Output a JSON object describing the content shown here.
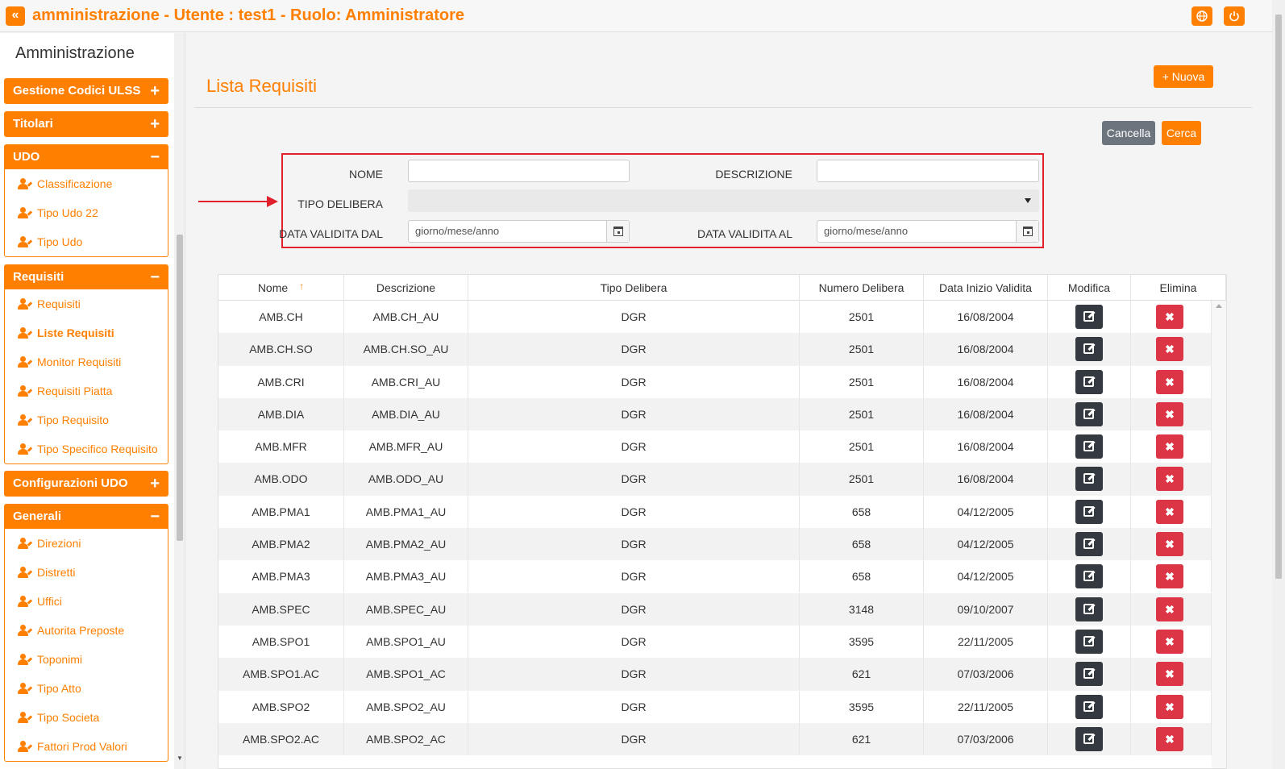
{
  "header": {
    "title": "amministrazione - Utente : test1 - Ruolo: Amministratore",
    "back_icon": "double-chevron-left-icon",
    "globe_icon": "globe-icon",
    "power_icon": "power-icon"
  },
  "sidebar": {
    "title": "Amministrazione",
    "groups": [
      {
        "label": "Gestione Codici ULSS",
        "sign": "+",
        "items": []
      },
      {
        "label": "Titolari",
        "sign": "+",
        "items": []
      },
      {
        "label": "UDO",
        "sign": "−",
        "items": [
          "Classificazione",
          "Tipo Udo 22",
          "Tipo Udo"
        ]
      },
      {
        "label": "Requisiti",
        "sign": "−",
        "items": [
          "Requisiti",
          "Liste Requisiti",
          "Monitor Requisiti",
          "Requisiti Piatta",
          "Tipo Requisito",
          "Tipo Specifico Requisito"
        ]
      },
      {
        "label": "Configurazioni UDO",
        "sign": "+",
        "items": []
      },
      {
        "label": "Generali",
        "sign": "−",
        "items": [
          "Direzioni",
          "Distretti",
          "Uffici",
          "Autorita Preposte",
          "Toponimi",
          "Tipo Atto",
          "Tipo Societa",
          "Fattori Prod Valori"
        ]
      }
    ]
  },
  "main": {
    "title": "Lista Requisiti",
    "new_button": "+ Nuova",
    "cancel_button": "Cancella",
    "search_button": "Cerca"
  },
  "filters": {
    "nome_label": "NOME",
    "nome_value": "",
    "descrizione_label": "DESCRIZIONE",
    "descrizione_value": "",
    "tipo_delibera_label": "TIPO DELIBERA",
    "tipo_delibera_value": "",
    "data_dal_label": "DATA VALIDITA DAL",
    "data_dal_value": "giorno/mese/anno",
    "data_al_label": "DATA VALIDITA AL",
    "data_al_value": "giorno/mese/anno"
  },
  "table": {
    "columns": [
      "Nome",
      "Descrizione",
      "Tipo Delibera",
      "Numero Delibera",
      "Data Inizio Validita",
      "Modifica",
      "Elimina"
    ],
    "sort_indicator": "↑",
    "delete_glyph": "✖",
    "rows": [
      [
        "AMB.CH",
        "AMB.CH_AU",
        "DGR",
        "2501",
        "16/08/2004"
      ],
      [
        "AMB.CH.SO",
        "AMB.CH.SO_AU",
        "DGR",
        "2501",
        "16/08/2004"
      ],
      [
        "AMB.CRI",
        "AMB.CRI_AU",
        "DGR",
        "2501",
        "16/08/2004"
      ],
      [
        "AMB.DIA",
        "AMB.DIA_AU",
        "DGR",
        "2501",
        "16/08/2004"
      ],
      [
        "AMB.MFR",
        "AMB.MFR_AU",
        "DGR",
        "2501",
        "16/08/2004"
      ],
      [
        "AMB.ODO",
        "AMB.ODO_AU",
        "DGR",
        "2501",
        "16/08/2004"
      ],
      [
        "AMB.PMA1",
        "AMB.PMA1_AU",
        "DGR",
        "658",
        "04/12/2005"
      ],
      [
        "AMB.PMA2",
        "AMB.PMA2_AU",
        "DGR",
        "658",
        "04/12/2005"
      ],
      [
        "AMB.PMA3",
        "AMB.PMA3_AU",
        "DGR",
        "658",
        "04/12/2005"
      ],
      [
        "AMB.SPEC",
        "AMB.SPEC_AU",
        "DGR",
        "3148",
        "09/10/2007"
      ],
      [
        "AMB.SPO1",
        "AMB.SPO1_AU",
        "DGR",
        "3595",
        "22/11/2005"
      ],
      [
        "AMB.SPO1.AC",
        "AMB.SPO1_AC",
        "DGR",
        "621",
        "07/03/2006"
      ],
      [
        "AMB.SPO2",
        "AMB.SPO2_AU",
        "DGR",
        "3595",
        "22/11/2005"
      ],
      [
        "AMB.SPO2.AC",
        "AMB.SPO2_AC",
        "DGR",
        "621",
        "07/03/2006"
      ]
    ]
  },
  "colors": {
    "accent": "#ff7f00",
    "danger": "#dc3545",
    "dark": "#343a40",
    "secondary": "#6c757d",
    "highlight": "#e0202a"
  }
}
